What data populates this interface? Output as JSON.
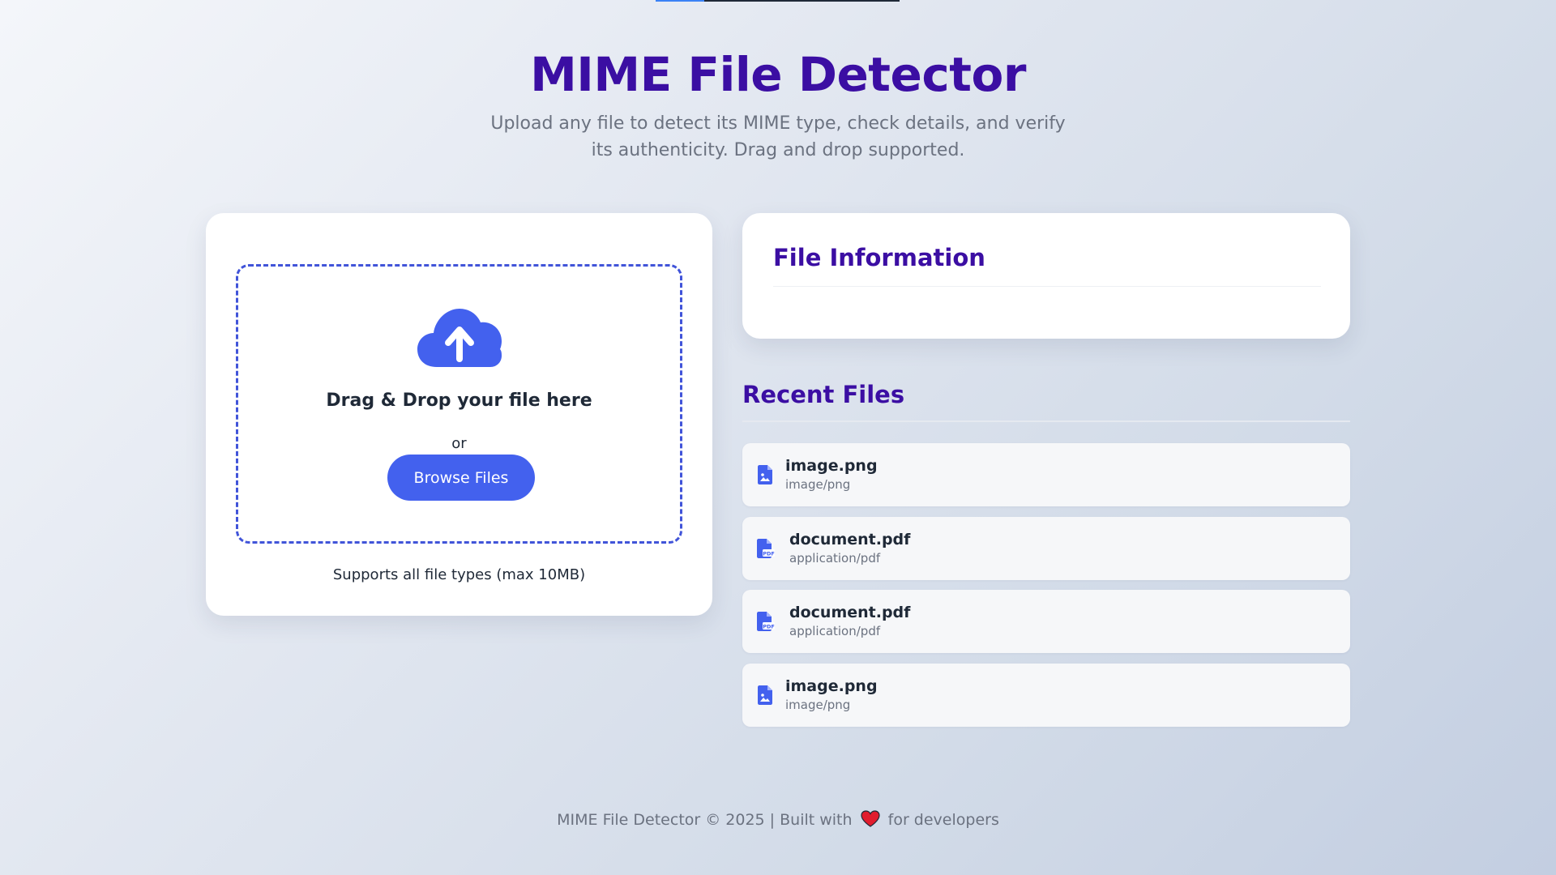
{
  "header": {
    "title": "MIME File Detector",
    "subtitle": "Upload any file to detect its MIME type, check details, and verify its authenticity. Drag and drop supported."
  },
  "top_progress": {
    "value_percent": 20
  },
  "upload": {
    "icon": "cloud-upload-icon",
    "drag_text": "Drag & Drop your file here",
    "or_text": "or",
    "browse_label": "Browse Files",
    "supports_text": "Supports all file types (max 10MB)"
  },
  "file_info": {
    "title": "File Information"
  },
  "recent": {
    "title": "Recent Files",
    "items": [
      {
        "name": "image.png",
        "type": "image/png",
        "icon": "image-file-icon"
      },
      {
        "name": "document.pdf",
        "type": "application/pdf",
        "icon": "pdf-file-icon"
      },
      {
        "name": "document.pdf",
        "type": "application/pdf",
        "icon": "pdf-file-icon"
      },
      {
        "name": "image.png",
        "type": "image/png",
        "icon": "image-file-icon"
      }
    ]
  },
  "footer": {
    "prefix": "MIME File Detector © 2025 | Built with",
    "suffix": "for developers",
    "icon": "heart-icon"
  },
  "colors": {
    "title": "#3b0ea3",
    "accent": "#4361ee",
    "heart": "#e11d2e"
  }
}
